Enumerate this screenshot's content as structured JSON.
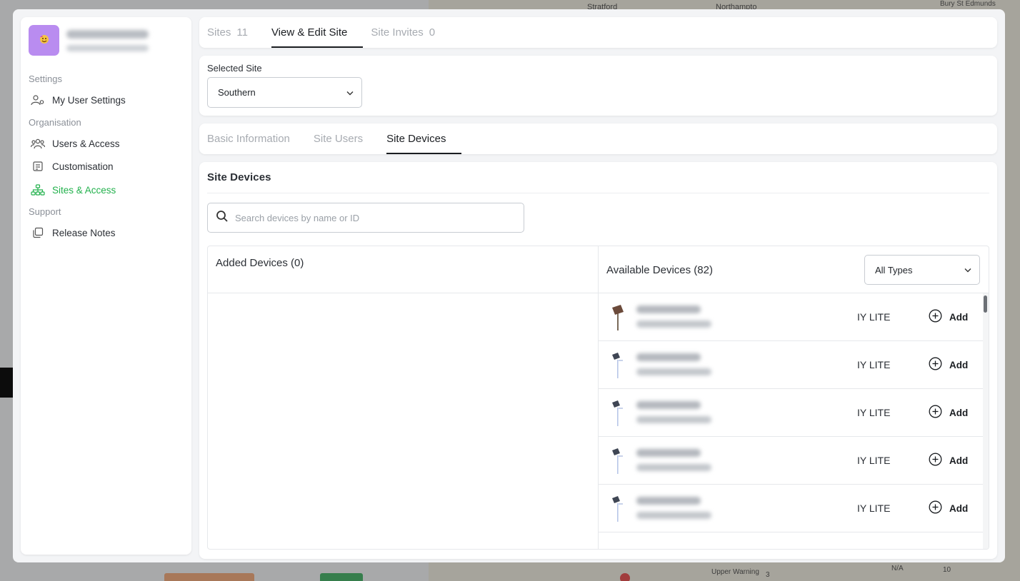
{
  "backdrop": {
    "map_labels": [
      "Stratford",
      "Northampto",
      "Bury St Edmunds",
      "Upper Warning",
      "N/A",
      "10",
      "3"
    ]
  },
  "sidebar": {
    "profile": {
      "avatar_icon": "user-emoji-icon"
    },
    "sections": {
      "settings": "Settings",
      "organisation": "Organisation",
      "support": "Support"
    },
    "items": [
      {
        "label": "My User Settings",
        "icon": "user-gear-icon"
      },
      {
        "label": "Users & Access",
        "icon": "users-icon"
      },
      {
        "label": "Customisation",
        "icon": "document-icon"
      },
      {
        "label": "Sites & Access",
        "icon": "sitemap-icon",
        "active": true
      },
      {
        "label": "Release Notes",
        "icon": "copy-icon"
      }
    ]
  },
  "top_tabs": [
    {
      "label": "Sites",
      "count": "11"
    },
    {
      "label": "View & Edit Site",
      "active": true
    },
    {
      "label": "Site Invites",
      "count": "0"
    }
  ],
  "site_select": {
    "label": "Selected Site",
    "value": "Southern"
  },
  "sub_tabs": [
    {
      "label": "Basic Information"
    },
    {
      "label": "Site Users"
    },
    {
      "label": "Site Devices",
      "active": true
    }
  ],
  "site_devices": {
    "title": "Site Devices",
    "search_placeholder": "Search devices by name or ID",
    "added_title": "Added Devices (0)",
    "available_title": "Available Devices (82)",
    "type_filter": "All Types",
    "add_label": "Add",
    "devices": [
      {
        "type": "IY LITE",
        "thumb": "sign-post"
      },
      {
        "type": "IY LITE",
        "thumb": "solar-pole"
      },
      {
        "type": "IY LITE",
        "thumb": "solar-pole"
      },
      {
        "type": "IY LITE",
        "thumb": "solar-pole"
      },
      {
        "type": "IY LITE",
        "thumb": "solar-pole"
      }
    ]
  },
  "colors": {
    "accent_green": "#22b14c",
    "text_dark": "#1a1d21",
    "text_muted": "#a7abb1"
  }
}
